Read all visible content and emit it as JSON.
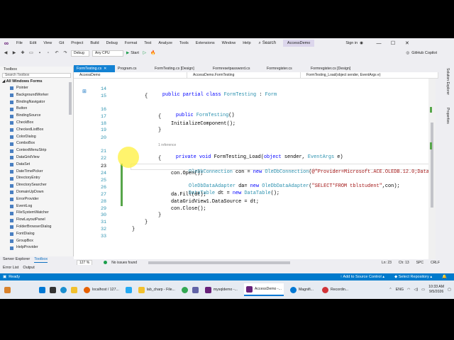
{
  "titlebar": {
    "menus": [
      "File",
      "Edit",
      "View",
      "Git",
      "Project",
      "Build",
      "Debug",
      "Format",
      "Test",
      "Analyze",
      "Tools",
      "Extensions",
      "Window",
      "Help"
    ],
    "search_label": "Search",
    "solution_name": "AccessDemo",
    "sign_in": "Sign in",
    "window_controls": [
      "—",
      "☐",
      "✕"
    ]
  },
  "toolbar": {
    "config": "Debug",
    "platform": "Any CPU",
    "start_label": "Start",
    "copilot": "GitHub Copilot"
  },
  "toolbox": {
    "title": "Toolbox",
    "search_placeholder": "Search Toolbox",
    "group": "All Windows Forms",
    "items": [
      "Pointer",
      "BackgroundWorker",
      "BindingNavigator",
      "Button",
      "BindingSource",
      "CheckBox",
      "CheckedListBox",
      "ColorDialog",
      "ComboBox",
      "ContextMenuStrip",
      "DataGridView",
      "DataSet",
      "DateTimePicker",
      "DirectoryEntry",
      "DirectorySearcher",
      "DomainUpDown",
      "ErrorProvider",
      "EventLog",
      "FileSystemWatcher",
      "FlowLayoutPanel",
      "FolderBrowserDialog",
      "FontDialog",
      "GroupBox",
      "HelpProvider"
    ],
    "bottom_tabs": [
      "Server Explorer",
      "Toolbox"
    ]
  },
  "doc_tabs": [
    "FormTesting.cs",
    "Program.cs",
    "FormTesting.cs [Design]",
    "Formresetpassword.cs",
    "Formregister.cs",
    "Formregister.cs [Design]"
  ],
  "nav_bar": [
    "AccessDemo",
    "AccessDemo.FormTesting",
    "FormTesting_Load(object sender, EventArgs e)"
  ],
  "editor": {
    "line_numbers": [
      "14",
      "15",
      "16",
      "17",
      "18",
      "19",
      "20",
      "21",
      "22",
      "23",
      "24",
      "25",
      "26",
      "27",
      "28",
      "29",
      "30",
      "31",
      "32",
      "33"
    ],
    "current_line": "23",
    "reference_hint": "1 reference",
    "code": {
      "l14": [
        "public partial class ",
        "FormTesting",
        " : ",
        "Form"
      ],
      "l15": "{",
      "l16": [
        "public ",
        "FormTesting",
        "()"
      ],
      "l17": "{",
      "l18": "InitializeComponent();",
      "l19": "}",
      "l21": [
        "private void ",
        "FormTesting_Load(",
        "object",
        " sender, ",
        "EventArgs",
        " e)"
      ],
      "l22": "{",
      "l23": [
        "OleDbConnection",
        " con = ",
        "new ",
        "OleDbConnection",
        "(",
        "@\"Provider=Microsoft.ACE.OLEDB.12.0;Data"
      ],
      "l24": "con.Open();",
      "l25": [
        "OleDbDataAdapter",
        " da= ",
        "new ",
        "OleDbDataAdapter",
        "(",
        "\"SELECT*FROM tblstudent\"",
        ",con);"
      ],
      "l26": [
        "DataTable",
        " dt = ",
        "new ",
        "DataTable",
        "();"
      ],
      "l27": "da.Fill(dt);",
      "l28": "dataGridView1.DataSource = dt;",
      "l29": "con.Close();",
      "l30": "}",
      "l31": "}",
      "l32": "}"
    }
  },
  "right_panels": [
    "Solution Explorer",
    "Properties"
  ],
  "editor_status": {
    "zoom": "127 %",
    "issues": "No issues found",
    "ln": "Ln: 23",
    "ch": "Ch: 13",
    "spc": "SPC",
    "crlf": "CRLF"
  },
  "error_tabs": [
    "Error List",
    "Output"
  ],
  "statusbar": {
    "ready": "Ready",
    "source_control": "Add to Source Control",
    "repository": "Select Repository"
  },
  "taskbar": {
    "apps": [
      "localhost / 127...",
      "lab_charp - File...",
      "mysqldemo -...",
      "AccessDemo -...",
      "Magnifi...",
      "Recordin..."
    ],
    "lang": "ENG",
    "time": "10:33 AM",
    "date": "9/5/2026"
  },
  "colors": {
    "accent": "#007acc",
    "keyword": "#0000ff",
    "type": "#2b91af",
    "string": "#a31515"
  }
}
